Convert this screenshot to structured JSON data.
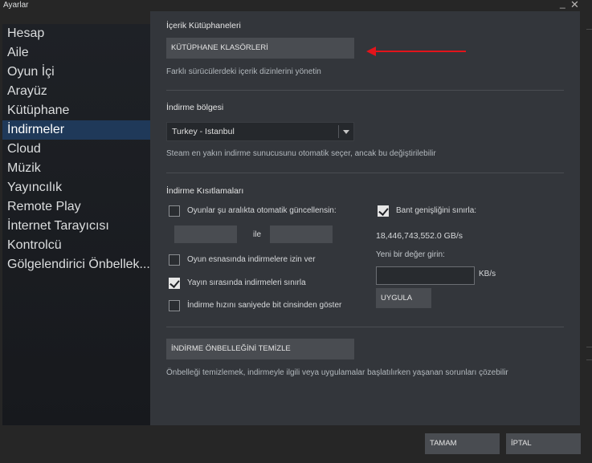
{
  "window": {
    "title": "Ayarlar",
    "minimize_glyph": "_",
    "close_glyph": "✕"
  },
  "sidebar": {
    "items": [
      {
        "label": "Hesap"
      },
      {
        "label": "Aile"
      },
      {
        "label": "Oyun İçi"
      },
      {
        "label": "Arayüz"
      },
      {
        "label": "Kütüphane"
      },
      {
        "label": "İndirmeler"
      },
      {
        "label": "Cloud"
      },
      {
        "label": "Müzik"
      },
      {
        "label": "Yayıncılık"
      },
      {
        "label": "Remote Play"
      },
      {
        "label": "İnternet Tarayıcısı"
      },
      {
        "label": "Kontrolcü"
      },
      {
        "label": "Gölgelendirici Önbellek..."
      }
    ],
    "active_index": 5
  },
  "library": {
    "title": "İçerik Kütüphaneleri",
    "button_label": "KÜTÜPHANE KLASÖRLERİ",
    "description": "Farklı sürücülerdeki içerik dizinlerini yönetin"
  },
  "region": {
    "title": "İndirme bölgesi",
    "selected": "Turkey - Istanbul",
    "description": "Steam en yakın indirme sunucusunu otomatik seçer, ancak bu değiştirilebilir"
  },
  "restrictions": {
    "title": "İndirme Kısıtlamaları",
    "auto_update": {
      "label": "Oyunlar şu aralıkta otomatik güncellensin:",
      "checked": false
    },
    "between_label": "ile",
    "allow_during_game": {
      "label": "Oyun esnasında indirmelere izin ver",
      "checked": false
    },
    "throttle_streaming": {
      "label": "Yayın sırasında indirmeleri sınırla",
      "checked": true
    },
    "show_bits": {
      "label": "İndirme hızını saniyede bit cinsinden göster",
      "checked": false
    },
    "limit_bandwidth": {
      "label": "Bant genişliğini sınırla:",
      "checked": true
    },
    "current_value": "18,446,743,552.0 GB/s",
    "new_value_label": "Yeni bir değer girin:",
    "new_value": "",
    "unit": "KB/s",
    "apply_label": "UYGULA"
  },
  "cache": {
    "button_label": "İNDİRME ÖNBELLEĞİNİ TEMİZLE",
    "description": "Önbelleği temizlemek, indirmeyle ilgili veya uygulamalar başlatılırken yaşanan sorunları çözebilir"
  },
  "footer": {
    "ok_label": "TAMAM",
    "cancel_label": "İPTAL"
  },
  "colors": {
    "accent": "#1f3959",
    "annotation_arrow": "#e3141b",
    "panel": "#33363b"
  }
}
